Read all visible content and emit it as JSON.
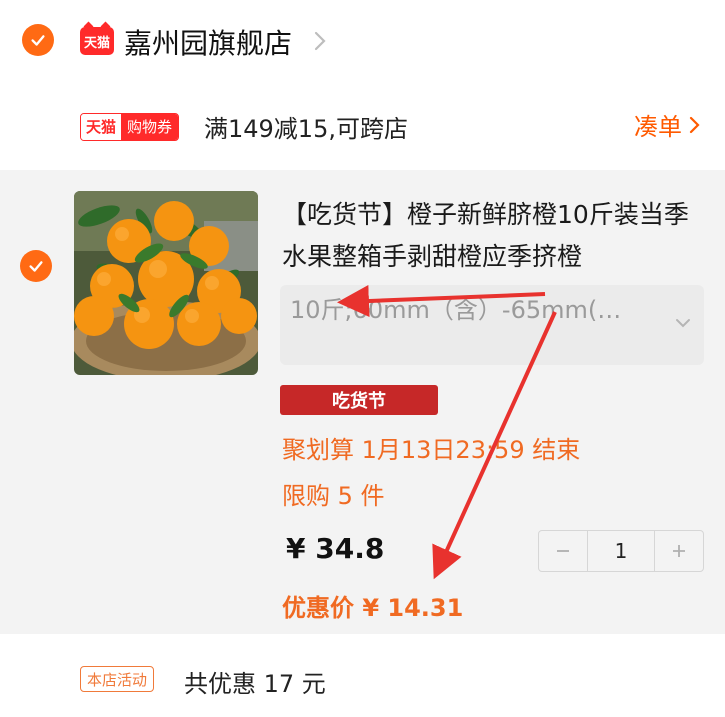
{
  "store": {
    "logo_text": "天猫",
    "name": "嘉州园旗舰店"
  },
  "coupon": {
    "badge_left": "天猫",
    "badge_right": "购物券",
    "text": "满149减15,可跨店",
    "gather_label": "凑单"
  },
  "product": {
    "title": "【吃货节】橙子新鲜脐橙10斤装当季水果整箱手剥甜橙应季挤橙",
    "sku": "10斤;60mm（含）-65mm(…",
    "festival_badge": "吃货节",
    "promo_line1": "聚划算 1月13日23:59 结束",
    "promo_line2": "限购 5 件",
    "price": "¥ 34.8",
    "quantity": "1",
    "discount_price": "优惠价 ¥ 14.31"
  },
  "activity": {
    "badge": "本店活动",
    "text": "共优惠 17 元"
  },
  "colors": {
    "accent": "#ff6a14",
    "tmall_red": "#ff2a2a",
    "promo_orange": "#f06a22",
    "annotation_red": "#e8322e"
  },
  "icons": {
    "check": "checkmark-circle-icon",
    "chevron": "chevron-right-icon",
    "dropdown": "chevron-down-icon"
  }
}
